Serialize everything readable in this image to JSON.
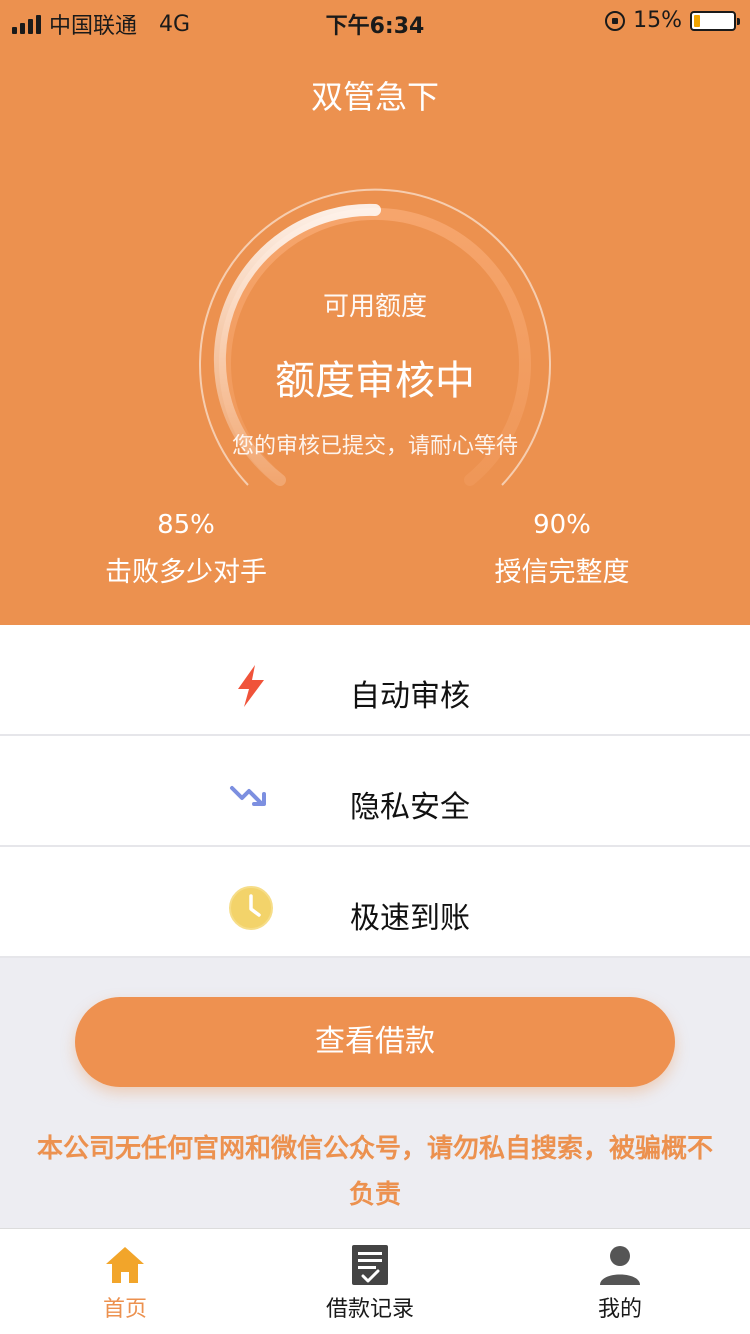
{
  "status_bar": {
    "carrier": "中国联通",
    "network": "4G",
    "time": "下午6:34",
    "battery": "15%",
    "battery_level": 0.15
  },
  "header": {
    "title": "双管急下"
  },
  "gauge": {
    "label": "可用额度",
    "status": "额度审核中",
    "note": "您的审核已提交，请耐心等待",
    "progress": 0.5
  },
  "stats": [
    {
      "value": "85%",
      "label": "击败多少对手"
    },
    {
      "value": "90%",
      "label": "授信完整度"
    }
  ],
  "features": [
    {
      "icon": "lightning-icon",
      "label": "自动审核"
    },
    {
      "icon": "trend-down-icon",
      "label": "隐私安全"
    },
    {
      "icon": "clock-icon",
      "label": "极速到账"
    }
  ],
  "main_button": {
    "label": "查看借款"
  },
  "disclaimer": "本公司无任何官网和微信公众号，请勿私自搜索，被骗概不负责",
  "tabbar": [
    {
      "icon": "home-icon",
      "label": "首页",
      "active": true
    },
    {
      "icon": "document-check-icon",
      "label": "借款记录",
      "active": false
    },
    {
      "icon": "user-icon",
      "label": "我的",
      "active": false
    }
  ],
  "colors": {
    "brand": "#ec914f",
    "feature_lightning": "#f0533a",
    "feature_trend": "#7c8fe0",
    "feature_clock": "#f3d36a"
  }
}
